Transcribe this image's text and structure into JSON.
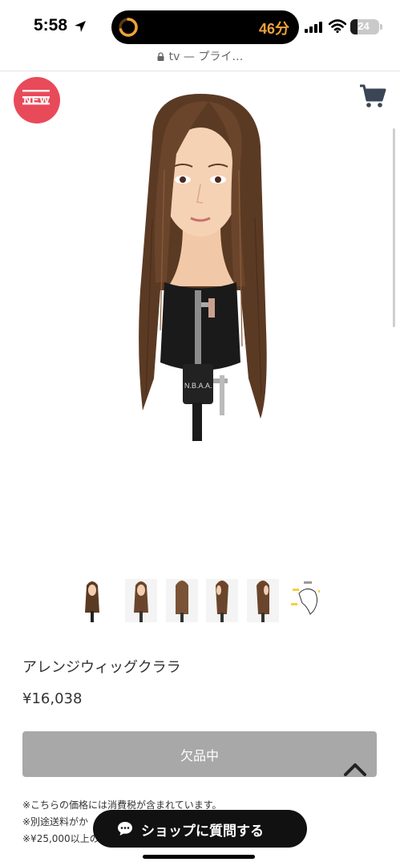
{
  "status_bar": {
    "time": "5:58",
    "activity_text": "46分",
    "battery_level": "24",
    "icons": [
      "location-arrow-icon",
      "timer-ring-icon",
      "cellular-signal-icon",
      "wifi-icon",
      "battery-icon"
    ]
  },
  "browser": {
    "url_text": "tv — プライ…",
    "icons": [
      "lock-icon"
    ]
  },
  "header": {
    "badge_text": "NEW",
    "icons": [
      "new-badge-icon",
      "cart-icon"
    ]
  },
  "gallery": {
    "thumbnail_count": 6,
    "selected_index": 0
  },
  "product": {
    "name": "アレンジウィッグクララ",
    "price": "¥16,038",
    "soldout_label": "欠品中"
  },
  "notes": {
    "line1": "※こちらの価格には消費税が含まれています。",
    "line2": "※別途送料がか",
    "line3": "※¥25,000以上の"
  },
  "chat": {
    "label": "ショップに質問する",
    "icon": "chat-bubble-icon"
  },
  "colors": {
    "badge": "#e94a5a",
    "soldout_button": "#a8a8a8",
    "chat_button": "#111111",
    "activity_text": "#f0a23a"
  }
}
